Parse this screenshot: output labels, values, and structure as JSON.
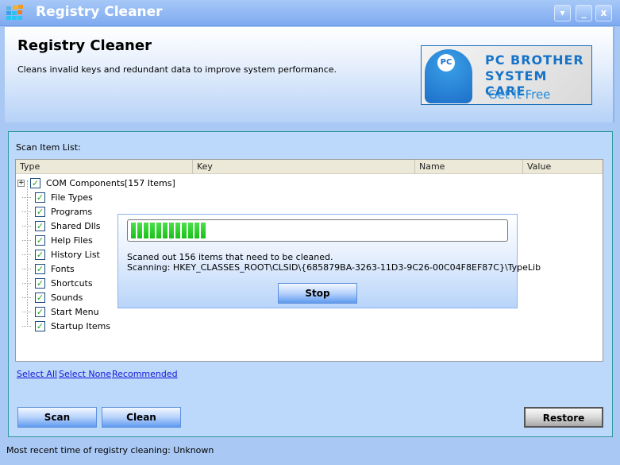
{
  "window": {
    "title": "Registry Cleaner",
    "controls": [
      "▾",
      "_",
      "x"
    ]
  },
  "header": {
    "title": "Registry Cleaner",
    "description": "Cleans invalid keys and redundant data to improve system performance.",
    "ad": {
      "line1": "PC BROTHER",
      "line2": "SYSTEM CARE",
      "cta": "Get It Free",
      "badge": "PC"
    }
  },
  "main": {
    "scan_label": "Scan Item List:",
    "columns": [
      "Type",
      "Key",
      "Name",
      "Value"
    ],
    "items": [
      {
        "label": "COM Components[157 Items]",
        "checked": true,
        "expandable": true
      },
      {
        "label": "File Types",
        "checked": true
      },
      {
        "label": "Programs",
        "checked": true
      },
      {
        "label": "Shared Dlls",
        "checked": true
      },
      {
        "label": "Help Files",
        "checked": true
      },
      {
        "label": "History List",
        "checked": true
      },
      {
        "label": "Fonts",
        "checked": true
      },
      {
        "label": "Shortcuts",
        "checked": true
      },
      {
        "label": "Sounds",
        "checked": true
      },
      {
        "label": "Start Menu",
        "checked": true
      },
      {
        "label": "Startup Items",
        "checked": true
      }
    ],
    "links": [
      "Select All",
      "Select None",
      "Recommended"
    ],
    "buttons": {
      "scan": "Scan",
      "clean": "Clean",
      "restore": "Restore"
    }
  },
  "progress": {
    "percent": 20,
    "message": "Scaned out 156 items that need to be cleaned.",
    "scanning": "Scanning: HKEY_CLASSES_ROOT\\CLSID\\{685879BA-3263-11D3-9C26-00C04F8EF87C}\\TypeLib",
    "stop": "Stop",
    "color": "#22c922"
  },
  "status": "Most recent time of registry cleaning: Unknown"
}
